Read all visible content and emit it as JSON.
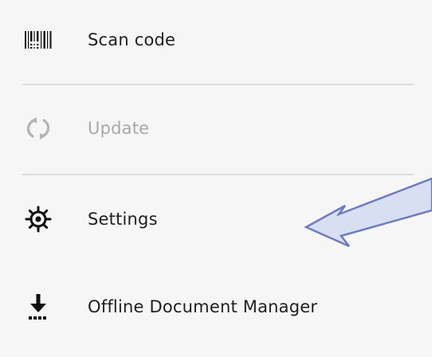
{
  "menu": {
    "items": [
      {
        "label": "Scan code",
        "icon": "barcode-icon",
        "enabled": true
      },
      {
        "label": "Update",
        "icon": "refresh-icon",
        "enabled": false
      },
      {
        "label": "Settings",
        "icon": "gear-icon",
        "enabled": true
      },
      {
        "label": "Offline Document Manager",
        "icon": "download-icon",
        "enabled": true
      }
    ]
  },
  "colors": {
    "panel_background": "#f6f6f6",
    "text_primary": "#1f1f1f",
    "text_disabled": "#a8a8a8",
    "divider": "#dcdcdc",
    "annotation_arrow_fill": "#d8dff2",
    "annotation_arrow_stroke": "#6b7bc4"
  }
}
